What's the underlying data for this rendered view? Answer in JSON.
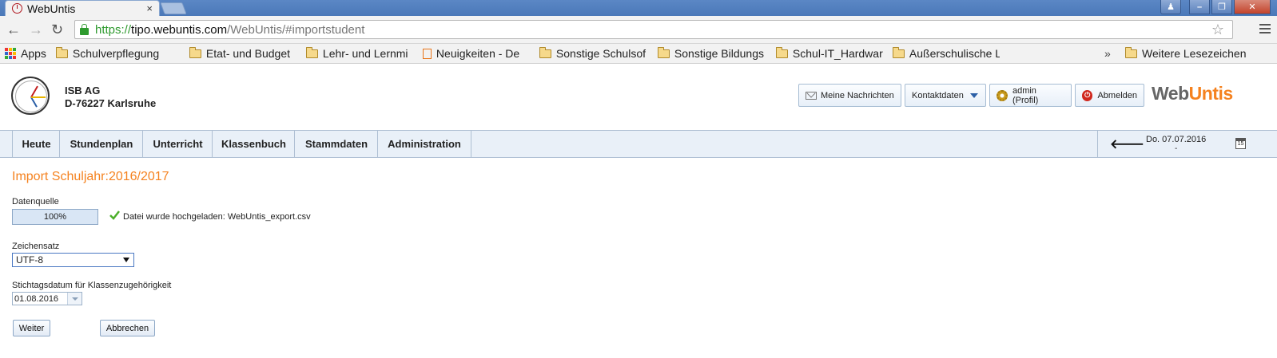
{
  "browser": {
    "tab_title": "WebUntis",
    "tab_close": "×",
    "url_scheme": "https://",
    "url_host": "tipo.webuntis.com",
    "url_path": "/WebUntis/#importstudent",
    "back": "←",
    "forward": "→",
    "reload": "↻",
    "star": "☆",
    "window_controls": {
      "minimize": "–",
      "maximize": "❐",
      "close": "✕"
    },
    "bookmarks": [
      {
        "label": "Apps",
        "icon": "apps-icon"
      },
      {
        "label": "Schulverpflegung",
        "icon": "folder-icon"
      },
      {
        "label": "Etat- und Budget",
        "icon": "folder-icon"
      },
      {
        "label": "Lehr- und Lernmi",
        "icon": "folder-icon"
      },
      {
        "label": "Neuigkeiten - De",
        "icon": "page-icon"
      },
      {
        "label": "Sonstige Schulsof",
        "icon": "folder-icon"
      },
      {
        "label": "Sonstige Bildungs",
        "icon": "folder-icon"
      },
      {
        "label": "Schul-IT_Hardwar",
        "icon": "folder-icon"
      },
      {
        "label": "Außerschulische L",
        "icon": "folder-icon"
      }
    ],
    "bookmarks_more": "»",
    "bookmarks_other": "Weitere Lesezeichen"
  },
  "header": {
    "school_name": "ISB AG",
    "school_city": "D-76227 Karlsruhe",
    "buttons": {
      "messages": "Meine Nachrichten",
      "contact": "Kontaktdaten",
      "profile": "admin (Profil)",
      "logout": "Abmelden"
    },
    "brand_web": "Web",
    "brand_untis": "Untis"
  },
  "menu": {
    "items": [
      "Heute",
      "Stundenplan",
      "Unterricht",
      "Klassenbuch",
      "Stammdaten",
      "Administration"
    ],
    "back": "🡐",
    "date": "Do. 07.07.2016",
    "date_sub": "-",
    "calendar_day": "15"
  },
  "form": {
    "title": "Import Schuljahr:2016/2017",
    "source_label": "Datenquelle",
    "progress": 1.0,
    "progress_text": "100%",
    "upload_message": "Datei wurde hochgeladen: WebUntis_export.csv",
    "charset_label": "Zeichensatz",
    "charset_value": "UTF-8",
    "reference_date_label": "Stichtagsdatum für Klassenzugehörigkeit",
    "reference_date_value": "01.08.2016",
    "next_button": "Weiter",
    "cancel_button": "Abbrechen"
  },
  "colors": {
    "accent_orange": "#f5821f",
    "menubar_bg": "#e9f0f8",
    "url_green": "#2e9a2e"
  }
}
